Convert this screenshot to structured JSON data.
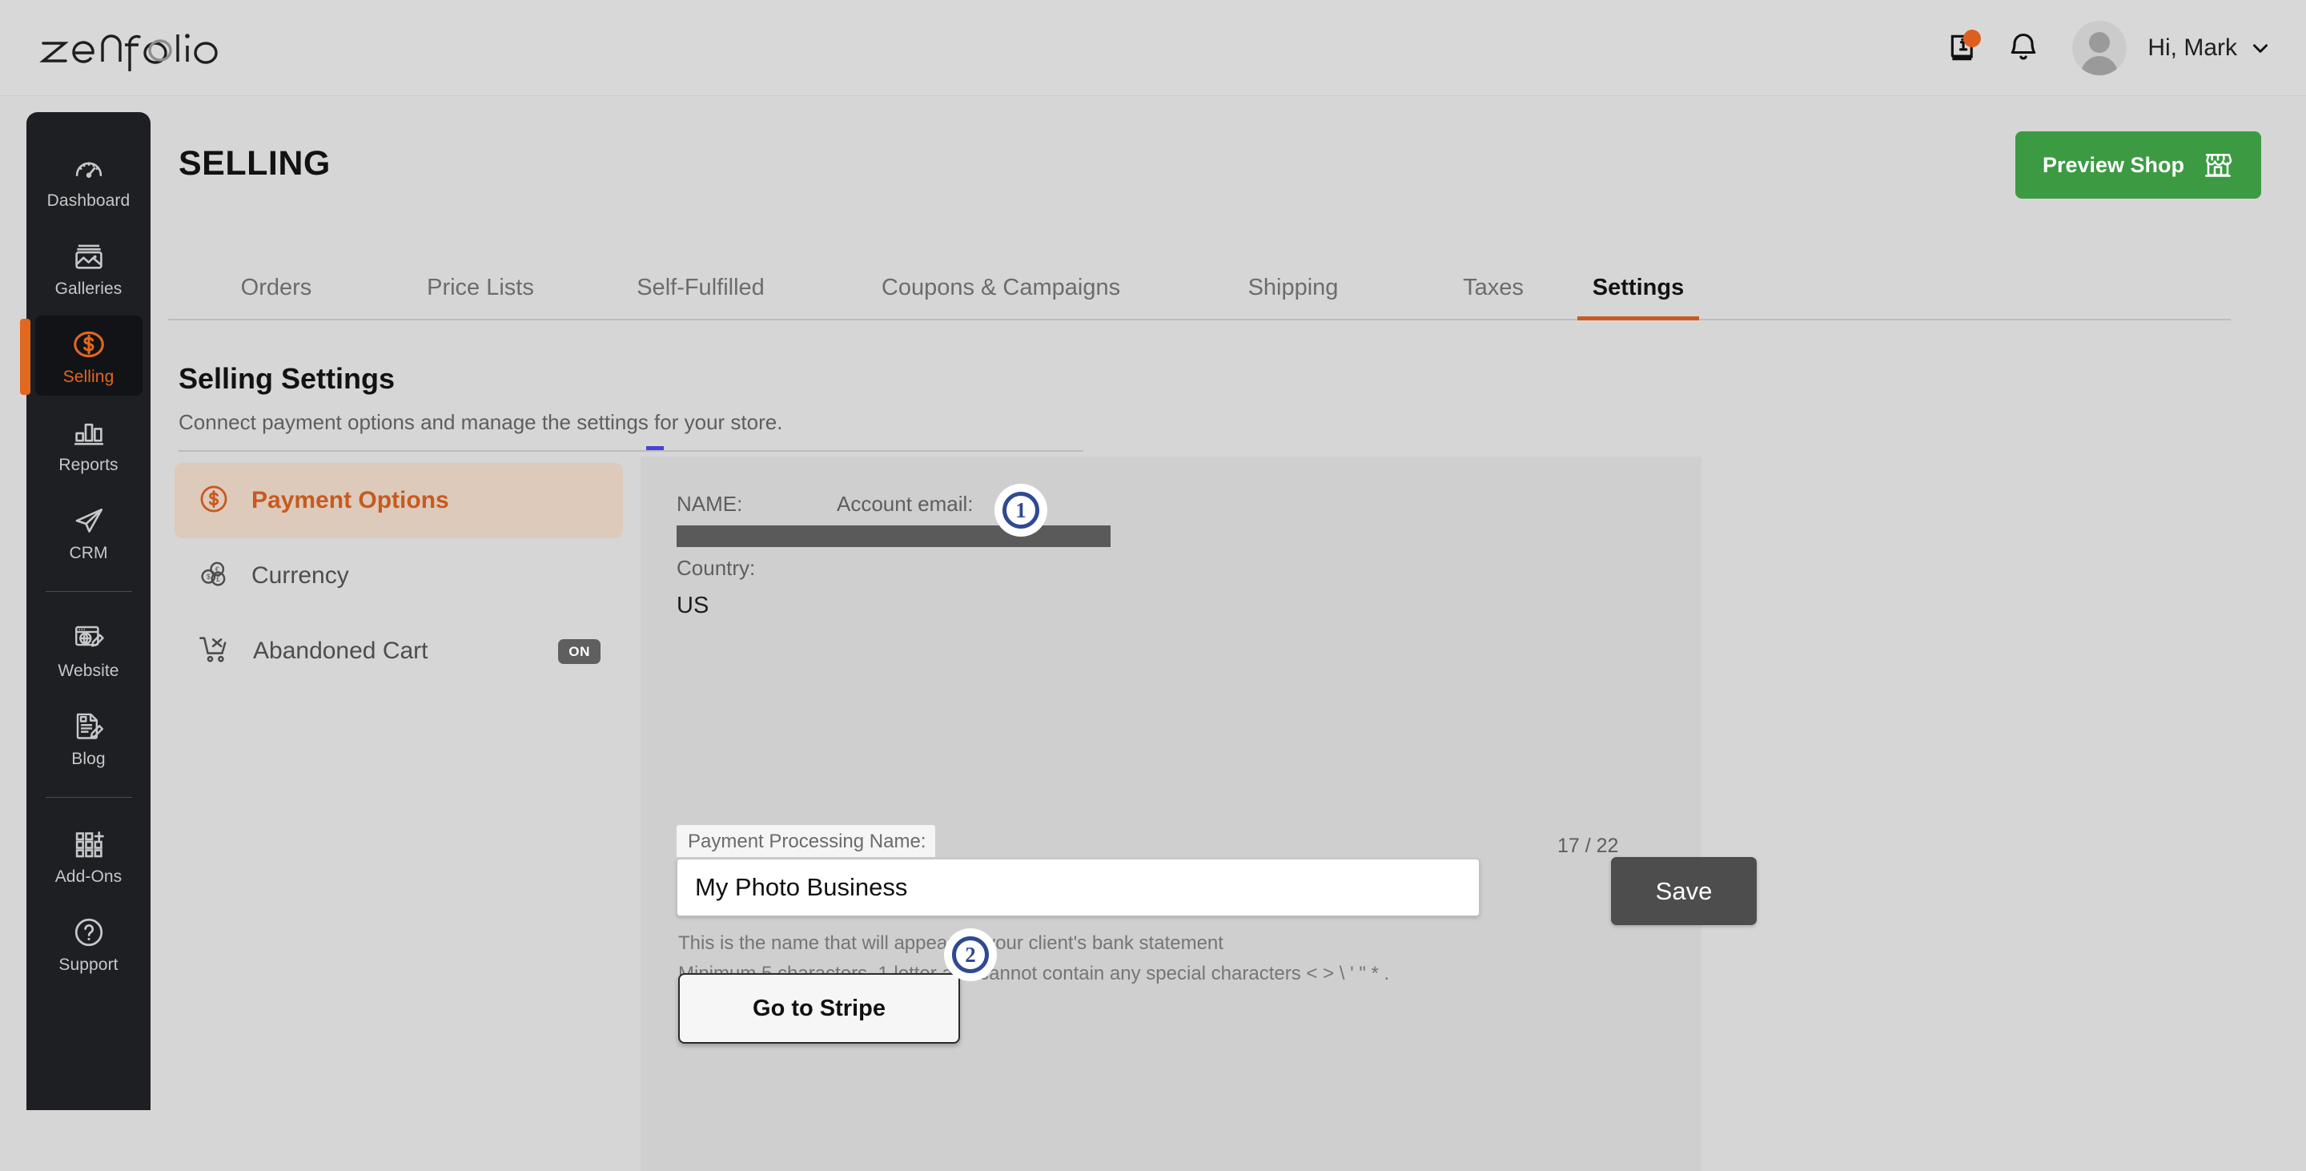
{
  "brand": {
    "logo_text": "zenfolio",
    "accent": "#e2671f",
    "green": "#3b9a42",
    "marker_blue": "#2e4a92"
  },
  "topbar": {
    "help_icon": "book-info-icon",
    "notifications_icon": "bell-icon",
    "avatar": "user-avatar",
    "greeting": "Hi, Mark",
    "chevron": "chevron-down-icon"
  },
  "sidebar": {
    "items": [
      {
        "label": "Dashboard",
        "icon": "gauge-icon",
        "active": false
      },
      {
        "label": "Galleries",
        "icon": "photo-icon",
        "active": false
      },
      {
        "label": "Selling",
        "icon": "dollar-circle-icon",
        "active": true
      },
      {
        "label": "Reports",
        "icon": "bar-chart-icon",
        "active": false
      },
      {
        "label": "CRM",
        "icon": "paper-plane-icon",
        "active": false
      },
      {
        "label": "Website",
        "icon": "browser-pencil-icon",
        "active": false
      },
      {
        "label": "Blog",
        "icon": "document-pencil-icon",
        "active": false
      },
      {
        "label": "Add-Ons",
        "icon": "grid-plus-icon",
        "active": false
      },
      {
        "label": "Support",
        "icon": "question-circle-icon",
        "active": false
      }
    ]
  },
  "page": {
    "title": "SELLING",
    "preview_shop_label": "Preview Shop",
    "preview_shop_icon": "storefront-icon"
  },
  "tabs": [
    {
      "label": "Orders",
      "active": false
    },
    {
      "label": "Price Lists",
      "active": false
    },
    {
      "label": "Self-Fulfilled",
      "active": false
    },
    {
      "label": "Coupons & Campaigns",
      "active": false
    },
    {
      "label": "Shipping",
      "active": false
    },
    {
      "label": "Taxes",
      "active": false
    },
    {
      "label": "Settings",
      "active": true
    }
  ],
  "section": {
    "title": "Selling Settings",
    "subtitle": "Connect payment options and manage the settings for your store."
  },
  "settings_nav": [
    {
      "label": "Payment Options",
      "icon": "dollar-circle-icon",
      "active": true,
      "badge": ""
    },
    {
      "label": "Currency",
      "icon": "coins-icon",
      "active": false,
      "badge": ""
    },
    {
      "label": "Abandoned Cart",
      "icon": "cart-x-icon",
      "active": false,
      "badge": "ON"
    }
  ],
  "payment": {
    "name_label": "NAME:",
    "name_value_redacted": true,
    "email_label": "Account email:",
    "email_value_redacted": true,
    "country_label": "Country:",
    "country_value": "US",
    "ppn_label": "Payment Processing Name:",
    "ppn_value": "My Photo Business",
    "ppn_placeholder": "Payment Processing Name",
    "char_count": "17 / 22",
    "save_label": "Save",
    "hint_line1": "This is the name that will appear on your client's bank statement",
    "hint_line2": "Minimum 5 characters, 1 letter and cannot contain any special characters < > \\ ' \" * .",
    "stripe_label": "Go to Stripe"
  },
  "annotations": [
    {
      "number": "1",
      "target": "payment-processing-name-input"
    },
    {
      "number": "2",
      "target": "go-to-stripe-button"
    }
  ]
}
